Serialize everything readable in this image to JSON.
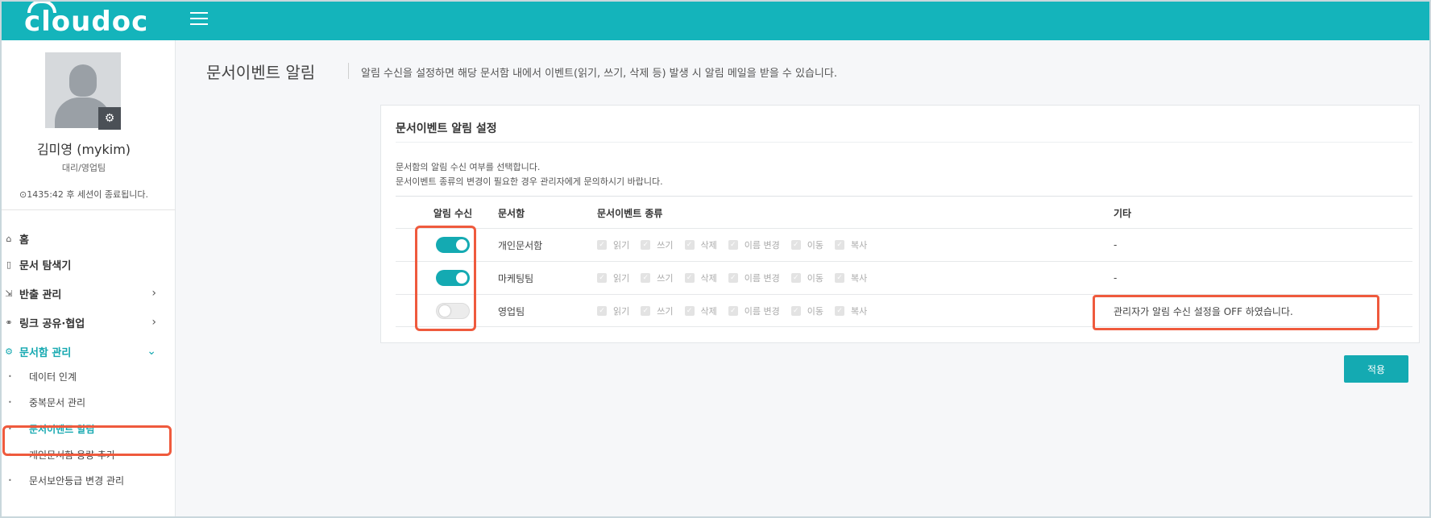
{
  "app": {
    "logo_text": "cloudoc",
    "menu_icon": "hamburger-icon"
  },
  "user": {
    "name": "김미영 (mykim)",
    "dept": "대리/영업팀",
    "session": "1435:42 후 세션이 종료됩니다.",
    "session_icon": "clock-icon",
    "settings_icon": "gear-icon"
  },
  "sidebar": {
    "items": [
      {
        "label": "홈",
        "icon": "home-icon"
      },
      {
        "label": "문서 탐색기",
        "icon": "document-icon"
      },
      {
        "label": "반출 관리",
        "icon": "export-icon"
      },
      {
        "label": "링크 공유·협업",
        "icon": "link-icon"
      },
      {
        "label": "문서함 관리",
        "icon": "folder-gear-icon"
      }
    ],
    "subitems": [
      {
        "label": "데이터 인계"
      },
      {
        "label": "중복문서 관리"
      },
      {
        "label": "문서이벤트 알림"
      },
      {
        "label": "개인문서함 용량 추가"
      },
      {
        "label": "문서보안등급 변경 관리"
      }
    ]
  },
  "page": {
    "title": "문서이벤트 알림",
    "description": "알림 수신을 설정하면 해당 문서함 내에서 이벤트(읽기, 쓰기, 삭제 등) 발생 시 알림 메일을 받을 수 있습니다."
  },
  "settings": {
    "title": "문서이벤트 알림 설정",
    "info1": "문서함의 알림 수신 여부를 선택합니다.",
    "info2": "문서이벤트 종류의 변경이 필요한 경우 관리자에게 문의하시기 바랍니다.",
    "columns": {
      "toggle": "알림 수신",
      "box": "문서함",
      "types": "문서이벤트 종류",
      "etc": "기타"
    },
    "event_types": [
      "읽기",
      "쓰기",
      "삭제",
      "이름 변경",
      "이동",
      "복사"
    ],
    "rows": [
      {
        "enabled": true,
        "box": "개인문서함",
        "etc": "-"
      },
      {
        "enabled": true,
        "box": "마케팅팀",
        "etc": "-"
      },
      {
        "enabled": false,
        "box": "영업팀",
        "etc": "관리자가 알림 수신 설정을 OFF 하였습니다."
      }
    ]
  },
  "apply_label": "적용",
  "colors": {
    "brand": "#14b4bb",
    "accent": "#14aab2",
    "highlight": "#ef5a3d"
  }
}
